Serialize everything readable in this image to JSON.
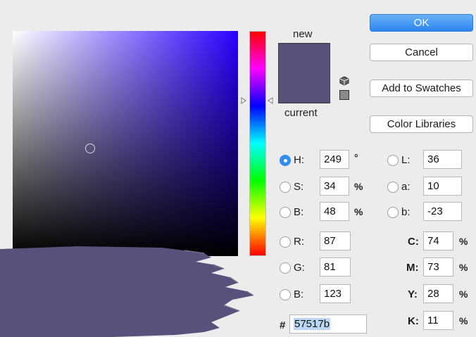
{
  "preview": {
    "new_label": "new",
    "current_label": "current",
    "color": "#57517b"
  },
  "buttons": {
    "ok": "OK",
    "cancel": "Cancel",
    "add_to_swatches": "Add to Swatches",
    "color_libraries": "Color Libraries"
  },
  "hsb": {
    "h": {
      "label": "H:",
      "value": "249",
      "unit": "°"
    },
    "s": {
      "label": "S:",
      "value": "34",
      "unit": "%"
    },
    "b": {
      "label": "B:",
      "value": "48",
      "unit": "%"
    }
  },
  "rgb": {
    "r": {
      "label": "R:",
      "value": "87"
    },
    "g": {
      "label": "G:",
      "value": "81"
    },
    "b": {
      "label": "B:",
      "value": "123"
    }
  },
  "lab": {
    "l": {
      "label": "L:",
      "value": "36"
    },
    "a": {
      "label": "a:",
      "value": "10"
    },
    "b": {
      "label": "b:",
      "value": "-23"
    }
  },
  "cmyk": {
    "c": {
      "label": "C:",
      "value": "74",
      "unit": "%"
    },
    "m": {
      "label": "M:",
      "value": "73",
      "unit": "%"
    },
    "y": {
      "label": "Y:",
      "value": "28",
      "unit": "%"
    },
    "k": {
      "label": "K:",
      "value": "11",
      "unit": "%"
    }
  },
  "hex": {
    "label": "#",
    "value": "57517b"
  },
  "selected_mode": "H",
  "colors": {
    "field_hue": "#2a00ff",
    "accent": "#2f8ef0",
    "smear": "#57517b"
  }
}
